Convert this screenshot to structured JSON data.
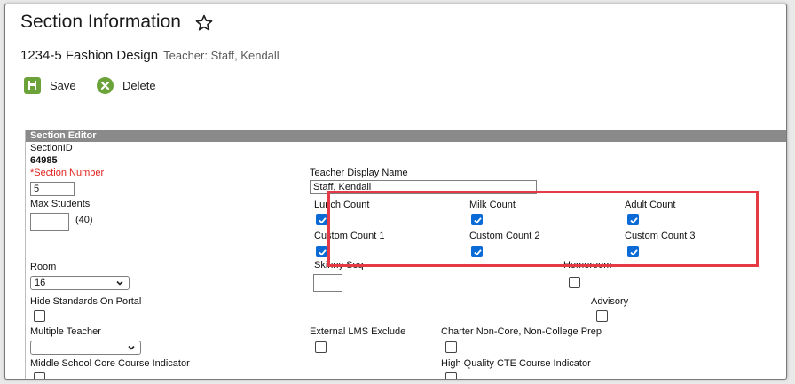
{
  "header": {
    "title": "Section Information",
    "course": "1234-5 Fashion Design",
    "teacher": "Teacher: Staff, Kendall"
  },
  "toolbar": {
    "save_label": "Save",
    "delete_label": "Delete"
  },
  "editor": {
    "heading": "Section Editor",
    "section_id_label": "SectionID",
    "section_id_value": "64985",
    "section_number_label": "*Section Number",
    "section_number_value": "5",
    "max_students_label": "Max Students",
    "max_students_value": "",
    "max_students_hint": "(40)",
    "teacher_display_name_label": "Teacher Display Name",
    "teacher_display_name_value": "Staff, Kendall",
    "counts": {
      "lunch_label": "Lunch Count",
      "lunch_checked": true,
      "milk_label": "Milk Count",
      "milk_checked": true,
      "adult_label": "Adult Count",
      "adult_checked": true,
      "custom1_label": "Custom Count 1",
      "custom1_checked": true,
      "custom2_label": "Custom Count 2",
      "custom2_checked": true,
      "custom3_label": "Custom Count 3",
      "custom3_checked": true
    },
    "room_label": "Room",
    "room_value": "16",
    "skinny_seq_label": "Skinny Seq",
    "homeroom_label": "Homeroom",
    "hide_standards_label": "Hide Standards On Portal",
    "advisory_label": "Advisory",
    "multiple_teacher_label": "Multiple Teacher",
    "multiple_teacher_value": "",
    "external_lms_label": "External LMS Exclude",
    "charter_label": "Charter Non-Core, Non-College Prep",
    "middle_school_label": "Middle School Core Course Indicator",
    "high_quality_cte_label": "High Quality CTE Course Indicator"
  },
  "colors": {
    "toolbar_icon": "#6ca23a",
    "editor_header": "#8a8a8a",
    "checkbox_checked": "#0b6bd6",
    "required_label": "#e0201a",
    "highlight_box": "#e53946"
  },
  "icons": {
    "title_star": "star-icon",
    "save": "floppy-icon",
    "delete": "x-circle-icon"
  }
}
